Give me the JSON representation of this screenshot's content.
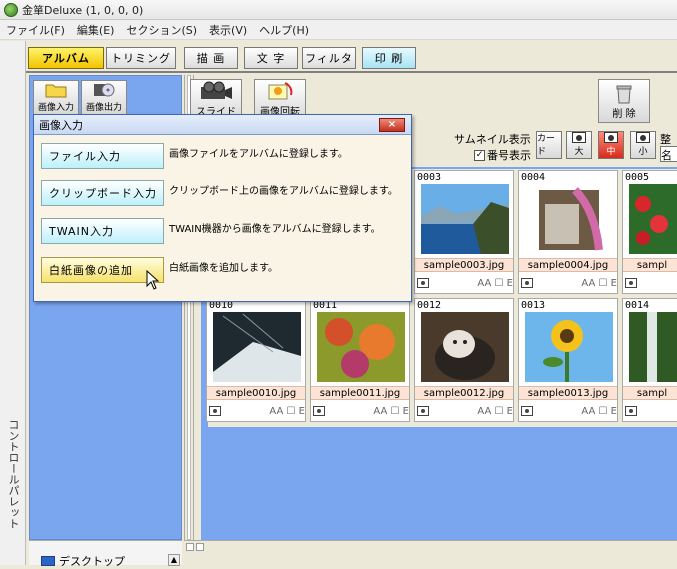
{
  "titlebar": {
    "title": "金箪Deluxe (1, 0, 0, 0)"
  },
  "menubar": {
    "items": [
      "ファイル(F)",
      "編集(E)",
      "セクション(S)",
      "表示(V)",
      "ヘルプ(H)"
    ]
  },
  "left_strip": {
    "label": "コントロールパレット"
  },
  "tabs": [
    "アルバム",
    "トリミング",
    "描 画",
    "文 字",
    "フィルタ",
    "印 刷"
  ],
  "left_panel": {
    "buttons": [
      "画像入力",
      "画像出力"
    ],
    "tree_item": "デスクトップ"
  },
  "toolbar": {
    "slide_label": "スライド",
    "rotate_label": "画像回転",
    "delete_label": "削 除",
    "thumbnail_label": "サムネイル表示",
    "number_checkbox": "番号表示",
    "card_label": "カード",
    "large_label": "大",
    "medium_label": "中",
    "small_label": "小",
    "arrange_label": "整",
    "sort_value": "名"
  },
  "dialog": {
    "title": "画像入力",
    "close": "×",
    "buttons": [
      {
        "label": "ファイル入力",
        "desc": "画像ファイルをアルバムに登録します。"
      },
      {
        "label": "クリップボード入力",
        "desc": "クリップボード上の画像をアルバムに登録します。"
      },
      {
        "label": "TWAIN入力",
        "desc": "TWAIN機器から画像をアルバムに登録します。"
      },
      {
        "label": "白紙画像の追加",
        "desc": "白紙画像を追加します。"
      }
    ]
  },
  "album": {
    "cards": [
      {
        "num": "0003",
        "fname": "sample0003.jpg"
      },
      {
        "num": "0004",
        "fname": "sample0004.jpg"
      },
      {
        "num": "0005",
        "fname": "sampl"
      },
      {
        "num": "0010",
        "fname": "sample0010.jpg"
      },
      {
        "num": "0011",
        "fname": "sample0011.jpg"
      },
      {
        "num": "0012",
        "fname": "sample0012.jpg"
      },
      {
        "num": "0013",
        "fname": "sample0013.jpg"
      },
      {
        "num": "0014",
        "fname": "sampl"
      }
    ],
    "card_foot_text": "AA ☐ E"
  },
  "colors": {
    "album_bg": "#7aa5ef",
    "active_tab": "#f2c300",
    "print_tab": "#a8e4f4",
    "dialog_border": "#3a68b2"
  }
}
